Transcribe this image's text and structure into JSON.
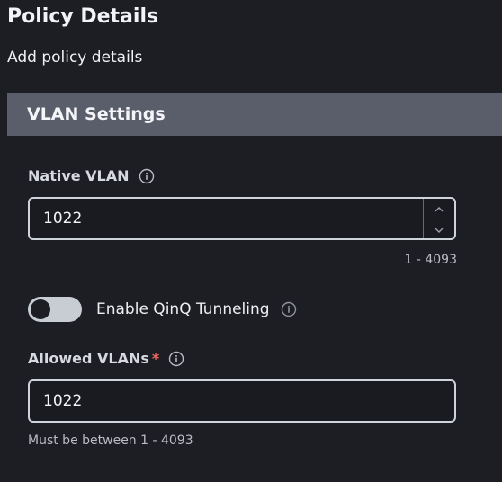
{
  "page": {
    "title": "Policy Details",
    "subtitle": "Add policy details"
  },
  "section": {
    "title": "VLAN Settings"
  },
  "native_vlan": {
    "label": "Native VLAN",
    "value": "1022",
    "range_hint": "1 - 4093"
  },
  "qinq": {
    "label": "Enable QinQ Tunneling",
    "enabled": false
  },
  "allowed_vlans": {
    "label": "Allowed VLANs",
    "required_marker": "*",
    "value": "1022",
    "helper": "Must be between 1 - 4093"
  },
  "icons": {
    "info": "info-icon",
    "stepper_up": "chevron-up-icon",
    "stepper_down": "chevron-down-icon"
  },
  "colors": {
    "background": "#1d1e23",
    "section_header": "#5a5e6a",
    "required": "#f06a63",
    "input_border": "#cfd3da"
  }
}
